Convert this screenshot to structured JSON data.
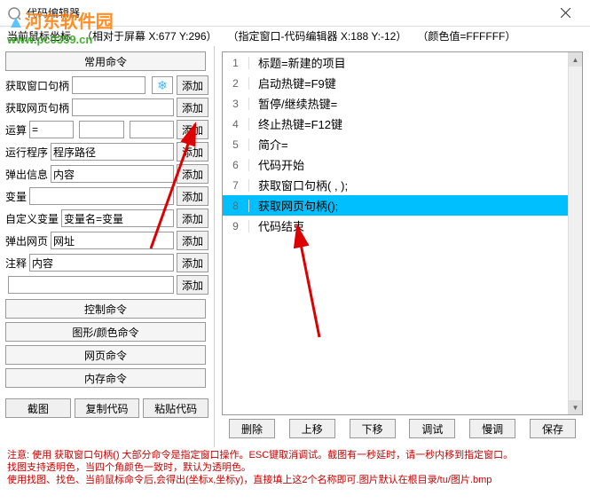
{
  "window": {
    "title": "代码编辑器"
  },
  "status": {
    "label": "当前鼠标坐标",
    "screen": "（相对于屏幕 X:677 Y:296）",
    "window_rel": "（指定窗口-代码编辑器 X:188 Y:-12）",
    "color": "（颜色值=FFFFFF）"
  },
  "watermark": {
    "text": "河东软件园",
    "url": "www.pc0359.cn"
  },
  "left": {
    "common_cmd": "常用命令",
    "control_cmd": "控制命令",
    "graphics_cmd": "图形/颜色命令",
    "web_cmd": "网页命令",
    "mem_cmd": "内存命令",
    "add": "添加",
    "rows": {
      "get_win_handle": "获取窗口句柄",
      "get_web_handle": "获取网页句柄",
      "compute": "运算",
      "run_program": "运行程序",
      "run_program_ph": "程序路径",
      "popup_info": "弹出信息",
      "popup_info_ph": "内容",
      "variable": "变量",
      "custom_var": "自定义变量",
      "custom_var_ph": "变量名=变量",
      "popup_web": "弹出网页",
      "popup_web_ph": "网址",
      "comment": "注释",
      "comment_ph": "内容"
    },
    "bottom": {
      "screenshot": "截图",
      "copy_code": "复制代码",
      "paste_code": "粘贴代码"
    }
  },
  "code": [
    {
      "n": 1,
      "t": "标题=新建的项目"
    },
    {
      "n": 2,
      "t": "启动热键=F9键"
    },
    {
      "n": 3,
      "t": "暂停/继续热键="
    },
    {
      "n": 4,
      "t": "终止热键=F12键"
    },
    {
      "n": 5,
      "t": "简介="
    },
    {
      "n": 6,
      "t": "代码开始"
    },
    {
      "n": 7,
      "t": "获取窗口句柄(                                                              ,                          );"
    },
    {
      "n": 8,
      "t": "获取网页句柄();",
      "sel": true
    },
    {
      "n": 9,
      "t": "代码结束"
    }
  ],
  "right_bottom": {
    "delete": "删除",
    "up": "上移",
    "down": "下移",
    "debug": "调试",
    "slow_debug": "慢调",
    "save": "保存"
  },
  "notes": {
    "l1": "注意: 使用 获取窗口句柄() 大部分命令是指定窗口操作。ESC键取消调试。截图有一秒延时，请一秒内移到指定窗口。",
    "l2": "找图支持透明色，当四个角颜色一致时，默认为透明色。",
    "l3": "使用找图、找色、当前鼠标命令后,会得出(坐标x,坐标y)，直接填上这2个名称即可.图片默认在根目录/tu/图片.bmp"
  }
}
